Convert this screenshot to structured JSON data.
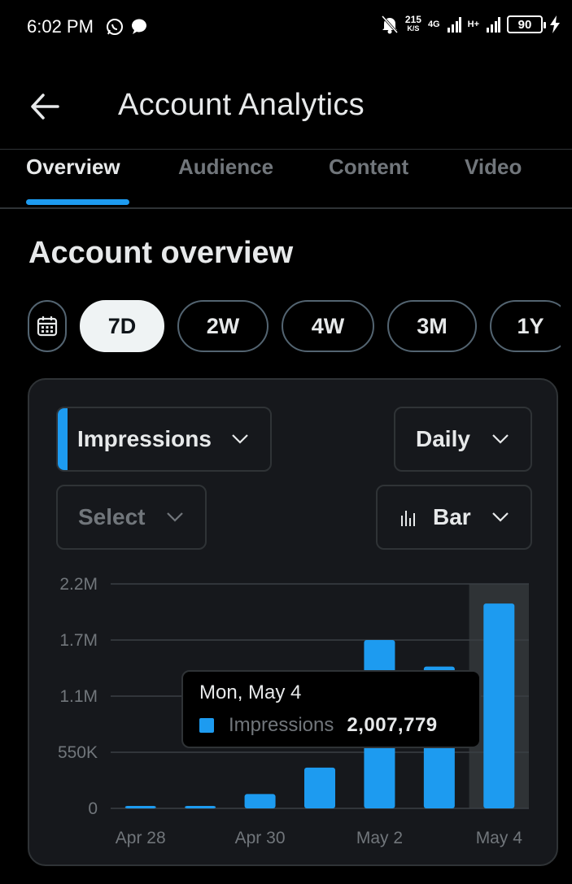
{
  "status_bar": {
    "time": "6:02 PM",
    "net_rate": "215",
    "net_rate_unit": "K/S",
    "network_1": "4G",
    "network_2": "H+",
    "battery": "90"
  },
  "header": {
    "title": "Account Analytics"
  },
  "tabs": [
    {
      "label": "Overview",
      "active": true
    },
    {
      "label": "Audience",
      "active": false
    },
    {
      "label": "Content",
      "active": false
    },
    {
      "label": "Video",
      "active": false
    }
  ],
  "section": {
    "title": "Account overview"
  },
  "ranges": [
    {
      "label": "7D",
      "selected": true
    },
    {
      "label": "2W",
      "selected": false
    },
    {
      "label": "4W",
      "selected": false
    },
    {
      "label": "3M",
      "selected": false
    },
    {
      "label": "1Y",
      "selected": false
    }
  ],
  "controls": {
    "metric": "Impressions",
    "interval": "Daily",
    "compare": "Select",
    "chart_type": "Bar"
  },
  "tooltip": {
    "date": "Mon, May 4",
    "series": "Impressions",
    "value": "2,007,779"
  },
  "colors": {
    "accent": "#1d9bf0",
    "background": "#000000",
    "card": "#16181c",
    "highlight": "#2f3336"
  },
  "chart_data": {
    "type": "bar",
    "categories": [
      "Apr 28",
      "Apr 29",
      "Apr 30",
      "May 1",
      "May 2",
      "May 3",
      "May 4"
    ],
    "x_tick_labels": [
      "Apr 28",
      "Apr 30",
      "May 2",
      "May 4"
    ],
    "series": [
      {
        "name": "Impressions",
        "values": [
          20000,
          20000,
          140000,
          400000,
          1650000,
          1390000,
          2007779
        ]
      }
    ],
    "y_ticks": [
      0,
      550000,
      1100000,
      1650000,
      2200000
    ],
    "y_tick_labels": [
      "0",
      "550K",
      "1.1M",
      "1.7M",
      "2.2M"
    ],
    "ylim": [
      0,
      2200000
    ],
    "highlighted_index": 6,
    "grid": true,
    "legend": "none"
  }
}
